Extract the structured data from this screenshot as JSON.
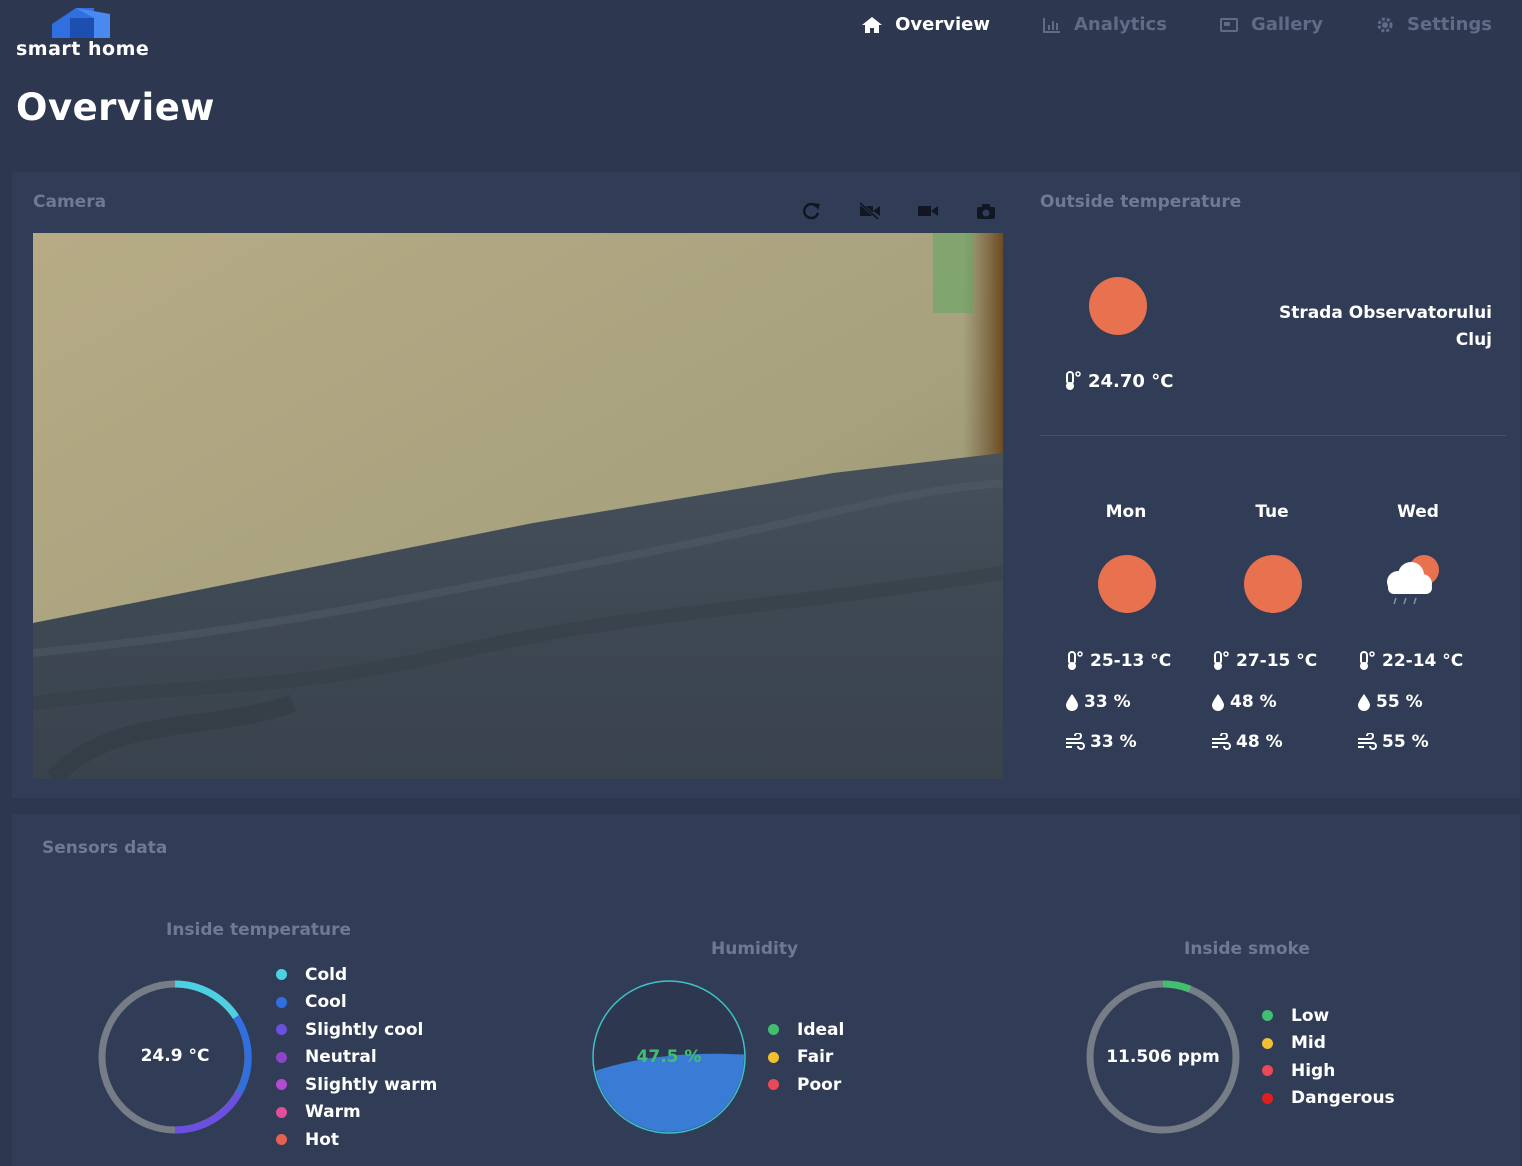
{
  "app": {
    "logo_text": "smart home"
  },
  "nav": [
    {
      "label": "Overview",
      "icon": "home-icon",
      "active": true
    },
    {
      "label": "Analytics",
      "icon": "chart-icon",
      "active": false
    },
    {
      "label": "Gallery",
      "icon": "gallery-icon",
      "active": false
    },
    {
      "label": "Settings",
      "icon": "gear-icon",
      "active": false
    }
  ],
  "page_title": "Overview",
  "camera": {
    "label": "Camera",
    "controls": [
      "refresh-icon",
      "video-off-icon",
      "video-camera-icon",
      "camera-icon"
    ]
  },
  "outside": {
    "label": "Outside temperature",
    "current_icon": "sun-icon",
    "current_temp": "24.70 °C",
    "location_line1": "Strada Observatorului",
    "location_line2": "Cluj"
  },
  "forecast": [
    {
      "day": "Mon",
      "icon": "sun-icon",
      "temp": "25-13 °C",
      "humidity": "33 %",
      "wind": "33 %"
    },
    {
      "day": "Tue",
      "icon": "sun-icon",
      "temp": "27-15 °C",
      "humidity": "48 %",
      "wind": "48 %"
    },
    {
      "day": "Wed",
      "icon": "cloud-sun-icon",
      "temp": "22-14 °C",
      "humidity": "55 %",
      "wind": "55 %"
    }
  ],
  "sensors": {
    "label": "Sensors data",
    "inside_temperature": {
      "title": "Inside temperature",
      "value": "24.9 °C",
      "legend": [
        {
          "label": "Cold",
          "color": "#4dd0e1"
        },
        {
          "label": "Cool",
          "color": "#2f6fe0"
        },
        {
          "label": "Slightly cool",
          "color": "#6a4fe0"
        },
        {
          "label": "Neutral",
          "color": "#8e44c8"
        },
        {
          "label": "Slightly warm",
          "color": "#b44ad0"
        },
        {
          "label": "Warm",
          "color": "#e0509a"
        },
        {
          "label": "Hot",
          "color": "#e8604f"
        }
      ]
    },
    "humidity": {
      "title": "Humidity",
      "value": "47.5 %",
      "level": 0.475,
      "legend": [
        {
          "label": "Ideal",
          "color": "#3fbf6f"
        },
        {
          "label": "Fair",
          "color": "#f2c12e"
        },
        {
          "label": "Poor",
          "color": "#e84a5a"
        }
      ]
    },
    "inside_smoke": {
      "title": "Inside smoke",
      "value": "11.506 ppm",
      "legend": [
        {
          "label": "Low",
          "color": "#3fbf6f"
        },
        {
          "label": "Mid",
          "color": "#f2c12e"
        },
        {
          "label": "High",
          "color": "#e84a5a"
        },
        {
          "label": "Dangerous",
          "color": "#e02020"
        }
      ]
    }
  }
}
